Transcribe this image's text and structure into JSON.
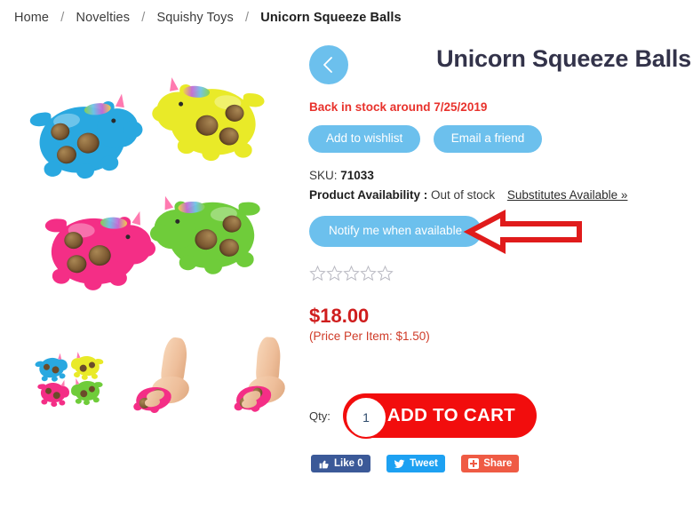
{
  "breadcrumb": {
    "items": [
      {
        "label": "Home",
        "current": false
      },
      {
        "label": "Novelties",
        "current": false
      },
      {
        "label": "Squishy Toys",
        "current": false
      },
      {
        "label": "Unicorn Squeeze Balls",
        "current": true
      }
    ],
    "separator": "/"
  },
  "product": {
    "title": "Unicorn Squeeze Balls",
    "back_stock_notice": "Back in stock around 7/25/2019",
    "sku_label": "SKU:",
    "sku_value": "71033",
    "availability_label": "Product Availability :",
    "availability_value": "Out of stock",
    "substitutes_link": "Substitutes Available »",
    "price": "$18.00",
    "price_per_item": "(Price Per Item: $1.50)",
    "rating_stars_total": 5,
    "rating_stars_filled": 0
  },
  "actions": {
    "back_icon": "chevron-left-icon",
    "add_to_wishlist": "Add to wishlist",
    "email_a_friend": "Email a friend",
    "notify_me": "Notify me when available",
    "qty_label": "Qty:",
    "qty_value": "1",
    "add_to_cart": "ADD TO CART"
  },
  "annotation": {
    "type": "arrow-left",
    "color": "#e01b1b",
    "points_to": "notify-me-when-available-button"
  },
  "social": [
    {
      "name": "facebook-like",
      "label": "Like 0",
      "icon": "thumbs-up-icon",
      "color": "#3b5998"
    },
    {
      "name": "twitter-tweet",
      "label": "Tweet",
      "icon": "twitter-bird-icon",
      "color": "#1da1f2"
    },
    {
      "name": "share",
      "label": "Share",
      "icon": "plus-box-icon",
      "color": "#ef5b44"
    }
  ],
  "media": {
    "main_image_alt": "Four unicorn squeeze balls in blue, yellow, pink and green",
    "thumbnails": [
      {
        "alt": "Group of four unicorn squeeze balls"
      },
      {
        "alt": "Hand squeezing pink unicorn squeeze ball"
      },
      {
        "alt": "Hand squeezing pink unicorn squeeze ball from side"
      }
    ]
  },
  "colors": {
    "accent_blue": "#6cc0ed",
    "cart_red": "#f20d0d",
    "price_red": "#cf1d1d",
    "notice_red": "#e8322c",
    "title_navy": "#33334a"
  }
}
